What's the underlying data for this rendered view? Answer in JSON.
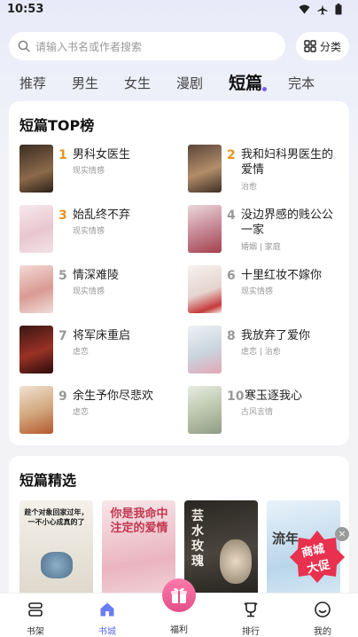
{
  "status": {
    "time": "10:53"
  },
  "search": {
    "placeholder": "请输入书名或作者搜索",
    "category_label": "分类"
  },
  "tabs": [
    "推荐",
    "男生",
    "女生",
    "漫剧",
    "短篇",
    "完本"
  ],
  "active_tab": "短篇",
  "top_list": {
    "title": "短篇TOP榜",
    "items": [
      {
        "rank": "1",
        "title": "男科女医生",
        "tag": "现实情感",
        "rank_color": "#e8931e"
      },
      {
        "rank": "2",
        "title": "我和妇科男医生的爱情",
        "tag": "治愈",
        "rank_color": "#e8931e"
      },
      {
        "rank": "3",
        "title": "始乱终不弃",
        "tag": "现实情感",
        "rank_color": "#e8931e"
      },
      {
        "rank": "4",
        "title": "没边界感的贱公公一家",
        "tag": "婚姻 | 家庭",
        "rank_color": "#999999"
      },
      {
        "rank": "5",
        "title": "情深难陵",
        "tag": "现实情感",
        "rank_color": "#999999"
      },
      {
        "rank": "6",
        "title": "十里红妆不嫁你",
        "tag": "现实情感",
        "rank_color": "#999999"
      },
      {
        "rank": "7",
        "title": "将军床重启",
        "tag": "虐恋",
        "rank_color": "#999999"
      },
      {
        "rank": "8",
        "title": "我放弃了爱你",
        "tag": "虐恋 | 治愈",
        "rank_color": "#999999"
      },
      {
        "rank": "9",
        "title": "余生予你尽悲欢",
        "tag": "虐恋",
        "rank_color": "#999999"
      },
      {
        "rank": "10",
        "title": "寒玉逐我心",
        "tag": "古风言情",
        "rank_color": "#999999"
      }
    ]
  },
  "featured": {
    "title": "短篇精选",
    "covers": [
      {
        "text": "趁个对象回家过年，一不小心成真的了"
      },
      {
        "text": "你是我命中注定的爱情"
      },
      {
        "text": "芸水玫瑰"
      },
      {
        "text": "流年"
      }
    ]
  },
  "promo": {
    "line1": "商城",
    "line2": "大促",
    "close": "×"
  },
  "bottom_nav": [
    {
      "label": "书架",
      "icon": "bookshelf-icon"
    },
    {
      "label": "书城",
      "icon": "home-icon"
    },
    {
      "label": "福利",
      "icon": "gift-icon"
    },
    {
      "label": "排行",
      "icon": "trophy-icon"
    },
    {
      "label": "我的",
      "icon": "profile-icon"
    }
  ],
  "colors": {
    "accent": "#5a6cf0",
    "rank_top": "#e8931e",
    "rank_other": "#999999",
    "welfare": "#e2508a"
  }
}
